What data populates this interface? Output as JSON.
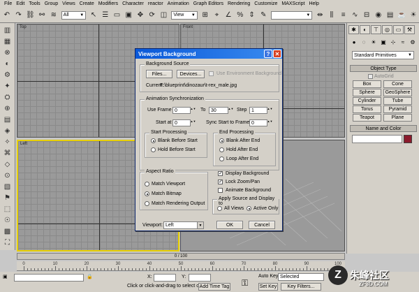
{
  "menu": [
    "File",
    "Edit",
    "Tools",
    "Group",
    "Views",
    "Create",
    "Modifiers",
    "Character",
    "reactor",
    "Animation",
    "Graph Editors",
    "Rendering",
    "Customize",
    "MAXScript",
    "Help"
  ],
  "toolbar": {
    "selection_filter": "All",
    "ref_coord": "View"
  },
  "viewports": {
    "top": "Top",
    "front": "Front",
    "left": "Left"
  },
  "command_panel": {
    "category": "Standard Primitives",
    "object_type_title": "Object Type",
    "autogrid": "AutoGrid",
    "objects": [
      "Box",
      "Cone",
      "Sphere",
      "GeoSphere",
      "Cylinder",
      "Tube",
      "Torus",
      "Pyramid",
      "Teapot",
      "Plane"
    ],
    "name_color_title": "Name and Color",
    "color": "#8b1a2c"
  },
  "dialog": {
    "title": "Viewport Background",
    "help_glyph": "?",
    "close_glyph": "✕",
    "background_source": {
      "label": "Background Source",
      "files_button": "Files...",
      "devices_button": "Devices...",
      "use_env": "Use Environment Background",
      "current_label": "Current:",
      "current_path": "F:\\blueprint\\dinozaur\\t-rex_male.jpg"
    },
    "anim_sync": {
      "label": "Animation Synchronization",
      "use_frame": "Use Frame",
      "use_frame_value": "0",
      "to": "To",
      "to_value": "30",
      "step": "Step",
      "step_value": "1",
      "start_at": "Start at",
      "start_at_value": "0",
      "sync_start": "Sync Start to Frame",
      "sync_start_value": "0",
      "start_processing": {
        "label": "Start Processing",
        "options": [
          "Blank Before Start",
          "Hold Before Start"
        ],
        "selected": 0
      },
      "end_processing": {
        "label": "End Processing",
        "options": [
          "Blank After End",
          "Hold After End",
          "Loop After End"
        ],
        "selected": 0
      }
    },
    "aspect_ratio": {
      "label": "Aspect Ratio",
      "options": [
        "Match Viewport",
        "Match Bitmap",
        "Match Rendering Output"
      ],
      "selected": 1
    },
    "checkboxes": [
      {
        "label": "Display Background",
        "checked": true
      },
      {
        "label": "Lock Zoom/Pan",
        "checked": true
      },
      {
        "label": "Animate Background",
        "checked": false
      }
    ],
    "apply": {
      "label": "Apply Source and Display to",
      "options": [
        "All Views",
        "Active Only"
      ],
      "selected": 1
    },
    "viewport_label": "Viewport:",
    "viewport_value": "Left",
    "ok": "OK",
    "cancel": "Cancel"
  },
  "timeline": {
    "slider": "0 / 100",
    "ticks": [
      "0",
      "10",
      "20",
      "30",
      "40",
      "50",
      "60",
      "70",
      "80",
      "90",
      "100"
    ]
  },
  "status": {
    "x_label": "X:",
    "y_label": "Y:",
    "auto_key": "Auto Key",
    "selected": "Selected",
    "set_key": "Set Key",
    "key_filters": "Key Filters...",
    "prompt": "Click or click-and-drag to select ob",
    "add_time_tag": "Add Time Tag",
    "frame": "0"
  },
  "watermark": {
    "text": "朱峰社区",
    "sub": "ZF3D.COM",
    "logo": "Z"
  }
}
